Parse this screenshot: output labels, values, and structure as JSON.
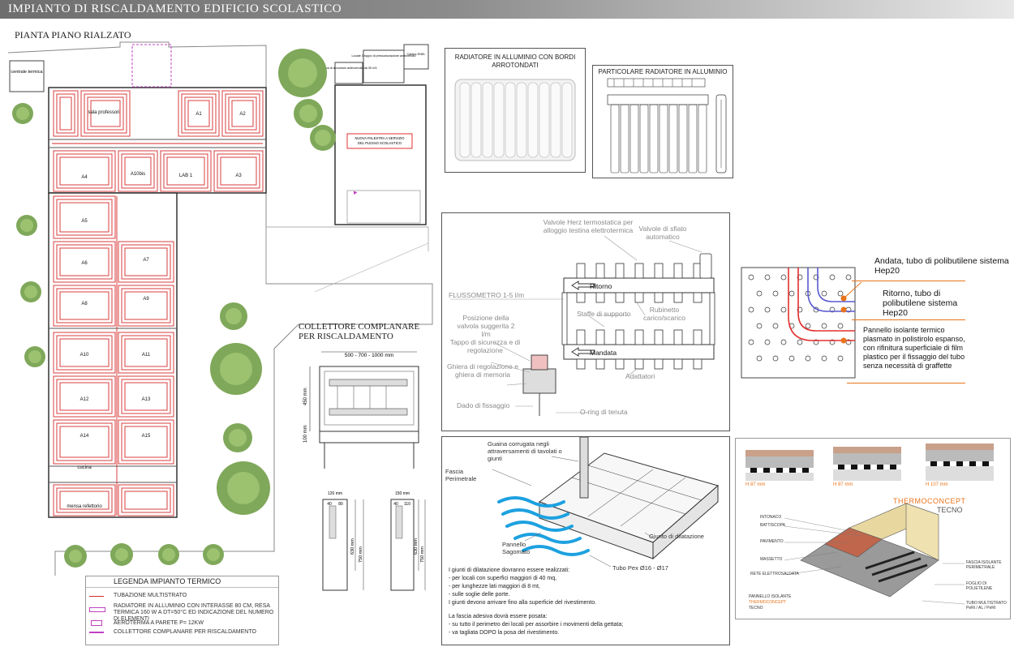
{
  "header": {
    "title": "IMPIANTO DI RISCALDAMENTO  EDIFICIO SCOLASTICO"
  },
  "plan": {
    "title": "PIANTA PIANO RIALZATO",
    "rooms": [
      "centrale termica",
      "sala professori",
      "A1",
      "A2",
      "A10bis",
      "LAB 1",
      "A3",
      "A4",
      "A5",
      "A6",
      "A7",
      "A8",
      "A9",
      "A10",
      "A11",
      "A12",
      "A13",
      "A14",
      "A15",
      "cucina",
      "mensa refettorio"
    ],
    "annex_labels": [
      "Locale Gruppo di pressurizzazione antincendio",
      "Vasca di accumulo antincendio da 30 m3",
      "Cabina ENEL"
    ],
    "gym_label": "NUOVA PALESTRA A SERVIZIO DEL PLESSO SCOLASTICO"
  },
  "legend": {
    "title": "LEGENDA IMPIANTO TERMICO",
    "items": [
      "TUBAZIONE MULTISTRATO",
      "RADIATORE IN ALLUMINIO CON INTERASSE 80 CM, RESA TERMICA 160 W A DT=50°C ED INDICAZIONE DEL NUMERO DI ELEMENTI",
      "AEROTERMA A PARETE P= 12KW",
      "COLLETTORE COMPLANARE PER RISCALDAMENTO"
    ]
  },
  "radiator1": {
    "title": "RADIATORE IN ALLUMINIO CON BORDI ARROTONDATI"
  },
  "radiator2": {
    "title": "PARTICOLARE RADIATORE IN ALLUMINIO"
  },
  "manifold": {
    "labels": {
      "valve": "Valvole Herz termostatica per alloggio testina elettrotermica",
      "vent": "Valvole di sfiato automatico",
      "flow": "FLUSSOMETRO 1-5 l/m",
      "ritorno": "Ritorno",
      "mandata": "Mandata",
      "staffe": "Staffe di supporto",
      "rubinetto": "Rubinetto carico/scarico",
      "posizione": "Posizione della valvola suggerita 2 l/m",
      "tappo": "Tappo di sicurezza e di regolazione",
      "ghiera": "Ghiera di regolazione e ghiera di memoria",
      "adattatori": "Adattatori",
      "dado": "Dado di fissaggio",
      "oring": "O-ring di tenuta"
    }
  },
  "panel": {
    "andata": "Andata, tubo di polibutilene sistema Hep20",
    "ritorno": "Ritorno, tubo di polibutilene sistema Hep20",
    "pannello": "Pannello isolante termico plasmato in polistirolo espanso, con rifinitura superficiale di film plastico per il fissaggio del tubo senza necessità di graffette"
  },
  "collector": {
    "title": "COLLETTORE COMPLANARE PER RISCALDAMENTO",
    "width_dim": "500 - 700 - 1000 mm",
    "height_dim": "450 mm",
    "base_dim": "100 mm",
    "side1": {
      "w": "120 mm",
      "a": "40",
      "b": "80",
      "h1": "630 mm",
      "h2": "750 mm"
    },
    "side2": {
      "w": "150 mm",
      "a": "40",
      "b": "110",
      "h1": "630 mm",
      "h2": "750 mm"
    }
  },
  "floor_section": {
    "labels": {
      "guaina": "Guaina corrugata negli attraversamenti di tavolati o giunti",
      "fascia": "Fascia Perimetrale",
      "pannello": "Pannello Sagomato",
      "giunto": "Giunto di dilatazione",
      "tubo": "Tubo Pex Ø16 - Ø17"
    },
    "notes": [
      "I giunti di dilatazione dovranno essere realizzati:",
      "- per locali con superfici maggiori di 40 mq,",
      "- per lunghezze lati maggiori di 8 mt,",
      "- sulle soglie delle porte.",
      "I giunti devono arrivare fino alla superficie del rivestimento.",
      "La fascia adesiva dovrà essere posata:",
      "- su tutto il perimetro dei locali per assorbire i movimenti della gettata;",
      "- va tagliata DOPO la posa del rivestimento."
    ]
  },
  "thermo": {
    "brand1": "THERMOCONCEPT",
    "brand2": "TECNO",
    "heights": [
      "H 87 mm",
      "H 97 mm",
      "H 107 mm"
    ],
    "left_labels": [
      "INTONACO",
      "BATTISCOPA",
      "PAVIMENTO",
      "MASSETTO",
      "RETE ELETTROSALDATA"
    ],
    "right_labels": [
      "FASCIA ISOLANTE PERIMETRALE",
      "FOGLIO DI POLIETILENE",
      "TUBO MULTISTRATO PeRt / AL / PeRt"
    ],
    "caption1": "PANNELLO ISOLANTE",
    "caption2": "THERMOCONCEPT",
    "caption3": "TECNO"
  },
  "colors": {
    "pipe": "#d42a2a",
    "accent_blue": "#1da1e0",
    "orange": "#e8731a",
    "header": "#7a7a7a"
  }
}
